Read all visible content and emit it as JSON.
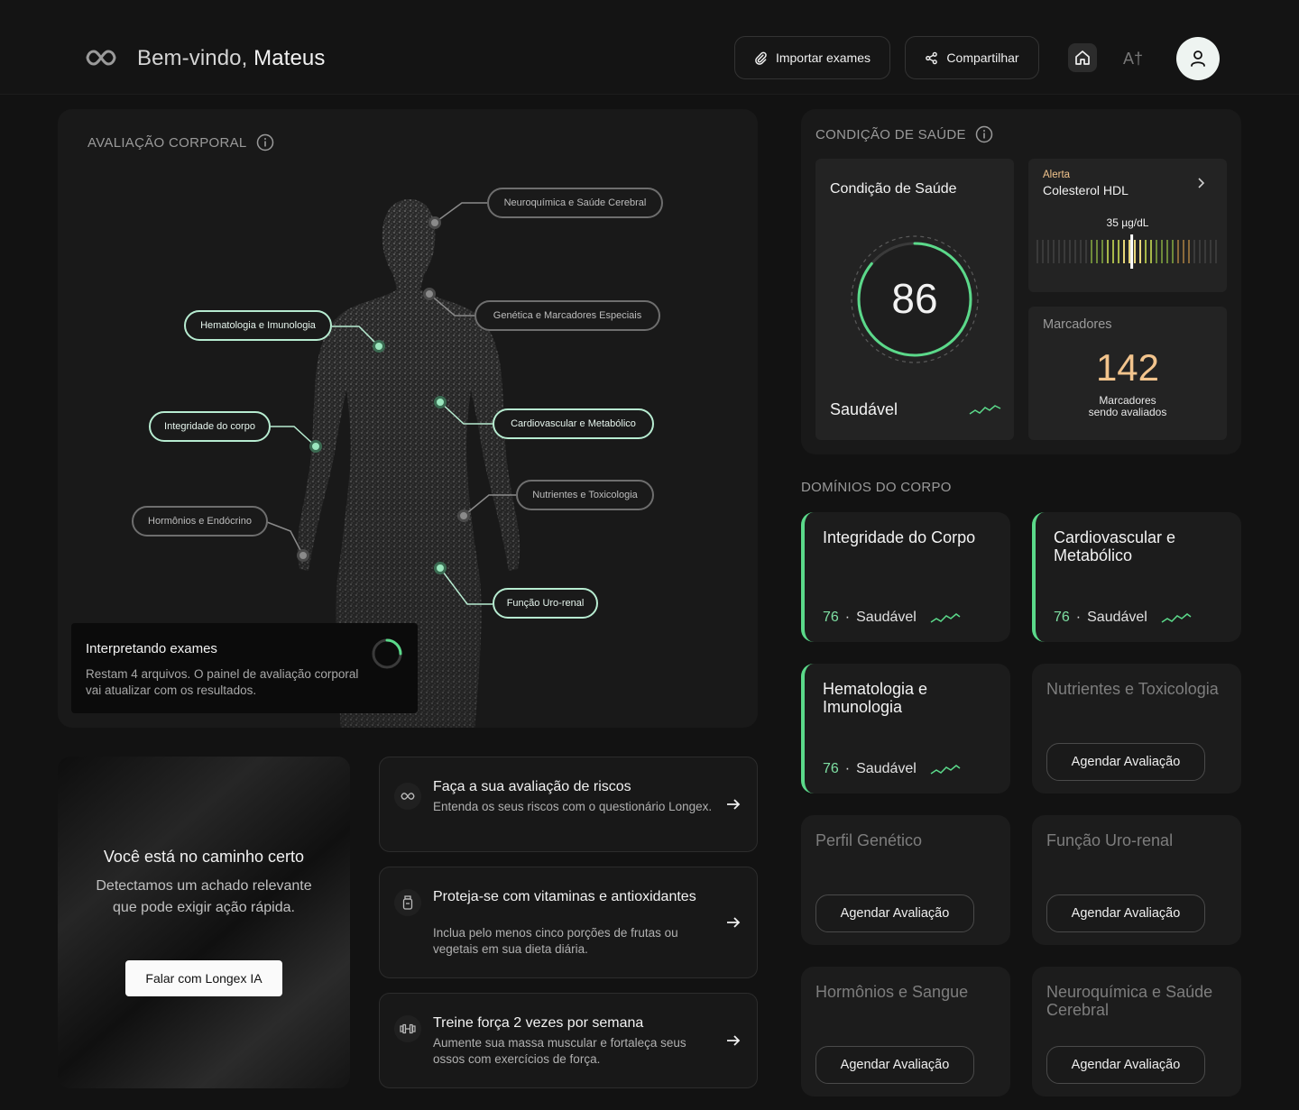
{
  "header": {
    "welcome_prefix": "Bem-vindo, ",
    "user_name": "Mateus",
    "import_label": "Importar exames",
    "share_label": "Compartilhar",
    "font_size_label": "A†"
  },
  "body_eval": {
    "title": "AVALIAÇÃO CORPORAL",
    "labels": {
      "neuro": "Neuroquímica e Saúde Cerebral",
      "genetics": "Genética e Marcadores Especiais",
      "hemato": "Hematologia e Imunologia",
      "cardio": "Cardiovascular e Metabólico",
      "integrity": "Integridade do corpo",
      "nutrients": "Nutrientes e Toxicologia",
      "hormones": "Hormônios e Endócrino",
      "uro": "Função Uro-renal"
    },
    "interpreting": {
      "title": "Interpretando exames",
      "desc": "Restam 4 arquivos. O painel de avaliação corporal vai atualizar com os resultados.",
      "progress": 0.25
    }
  },
  "health": {
    "title": "CONDIÇÃO DE SAÚDE",
    "score_card_title": "Condição de Saúde",
    "score": "86",
    "score_value": 86,
    "status": "Saudável",
    "alert_tag": "Alerta",
    "alert_name": "Colesterol HDL",
    "alert_value": "35 µg/dL",
    "alert_position": 0.52,
    "markers_title": "Marcadores",
    "markers_count": "142",
    "markers_desc_1": "Marcadores",
    "markers_desc_2": "sendo avaliados"
  },
  "domains": {
    "title": "DOMÍNIOS DO CORPO",
    "schedule_label": "Agendar Avaliação",
    "items": [
      {
        "name": "Integridade do Corpo",
        "score": "76",
        "status": "Saudável"
      },
      {
        "name": "Cardiovascular e Metabólico",
        "score": "76",
        "status": "Saudável"
      },
      {
        "name": "Hematologia e Imunologia",
        "score": "76",
        "status": "Saudável"
      },
      {
        "name": "Nutrientes e Toxicologia"
      },
      {
        "name": "Perfil Genético"
      },
      {
        "name": "Função Uro-renal"
      },
      {
        "name": "Hormônios e Sangue"
      },
      {
        "name": "Neuroquímica e Saúde Cerebral"
      }
    ]
  },
  "cta": {
    "title": "Você está no caminho certo",
    "desc": "Detectamos um achado relevante que pode exigir ação rápida.",
    "button": "Falar com Longex IA"
  },
  "tips": [
    {
      "title": "Faça a sua avaliação de riscos",
      "desc": "Entenda os seus riscos com o questionário Longex."
    },
    {
      "title": "Proteja-se com vitaminas e antioxidantes",
      "desc": "Inclua pelo menos cinco porções de frutas ou vegetais em sua dieta diária."
    },
    {
      "title": "Treine força 2 vezes por semana",
      "desc": "Aumente sua massa muscular e fortaleça seus ossos com exercícios de força."
    }
  ],
  "colors": {
    "accent": "#5bd98a",
    "alert": "#f2c48d",
    "background": "#121212"
  }
}
